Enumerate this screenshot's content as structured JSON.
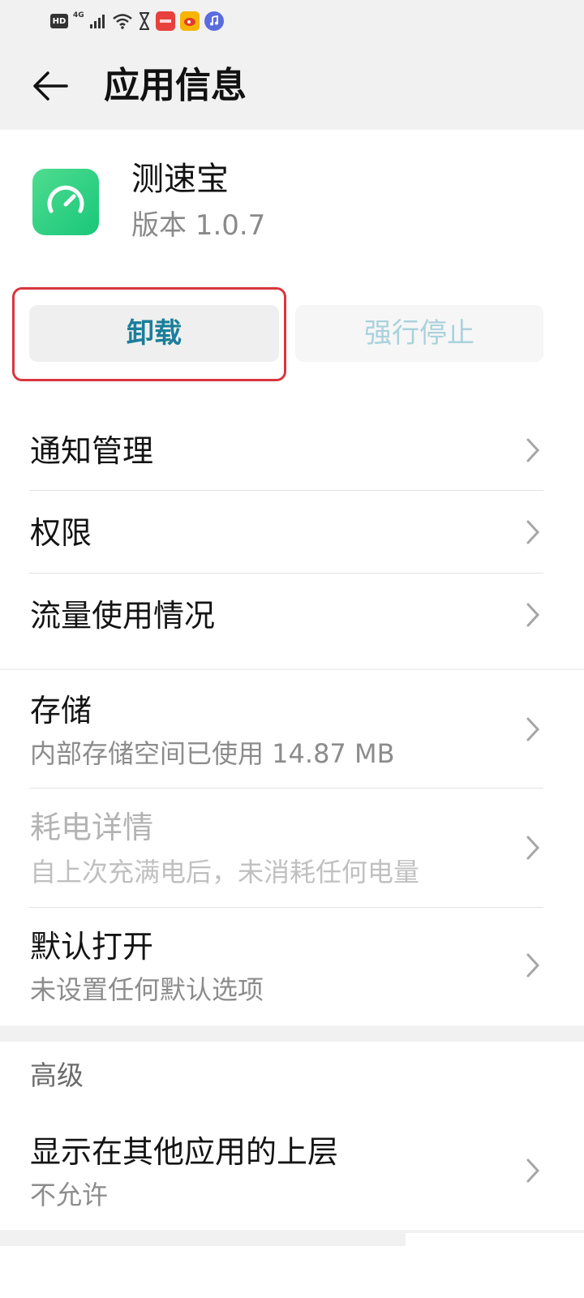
{
  "status_bar": {
    "hd_label": "HD",
    "network_label": "4G",
    "icons": [
      "hd-icon",
      "signal-icon",
      "wifi-icon",
      "hourglass-icon",
      "huawei-app-icon",
      "weibo-icon",
      "music-icon"
    ]
  },
  "app_bar": {
    "title": "应用信息"
  },
  "app": {
    "name": "测速宝",
    "version": "版本 1.0.7",
    "icon_color": "#1fcc80"
  },
  "actions": {
    "uninstall_label": "卸载",
    "force_stop_label": "强行停止",
    "accent_color": "#1b7e9a",
    "highlight_color": "#d9363e"
  },
  "settings_group_1": [
    {
      "title": "通知管理"
    },
    {
      "title": "权限"
    },
    {
      "title": "流量使用情况"
    }
  ],
  "settings_group_2": [
    {
      "title": "存储",
      "subtitle": "内部存储空间已使用 14.87 MB"
    },
    {
      "title": "耗电详情",
      "subtitle": "自上次充满电后，未消耗任何电量"
    },
    {
      "title": "默认打开",
      "subtitle": "未设置任何默认选项"
    }
  ],
  "settings_group_3": {
    "section_label": "高级",
    "items": [
      {
        "title": "显示在其他应用的上层",
        "subtitle": "不允许"
      }
    ]
  }
}
